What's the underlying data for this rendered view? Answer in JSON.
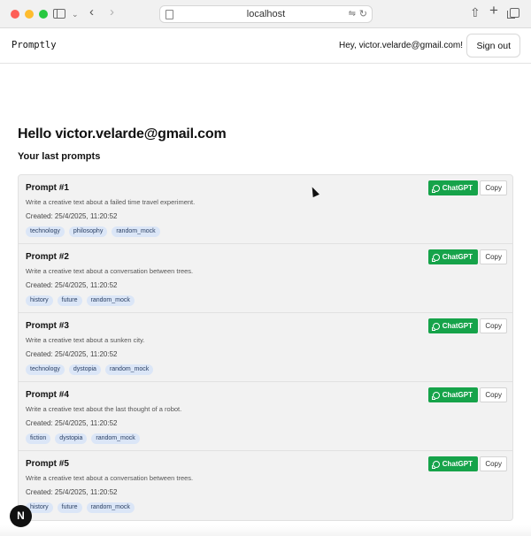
{
  "browser": {
    "url": "localhost"
  },
  "header": {
    "brand": "Promptly",
    "greeting": "Hey, victor.velarde@gmail.com!",
    "signout_label": "Sign out"
  },
  "main": {
    "title": "Hello victor.velarde@gmail.com",
    "section_title": "Your last prompts",
    "chatgpt_label": "ChatGPT",
    "copy_label": "Copy",
    "prompts": [
      {
        "title": "Prompt #1",
        "description": "Write a creative text about a failed time travel experiment.",
        "created": "Created: 25/4/2025, 11:20:52",
        "tags": [
          "technology",
          "philosophy",
          "random_mock"
        ]
      },
      {
        "title": "Prompt #2",
        "description": "Write a creative text about a conversation between trees.",
        "created": "Created: 25/4/2025, 11:20:52",
        "tags": [
          "history",
          "future",
          "random_mock"
        ]
      },
      {
        "title": "Prompt #3",
        "description": "Write a creative text about a sunken city.",
        "created": "Created: 25/4/2025, 11:20:52",
        "tags": [
          "technology",
          "dystopia",
          "random_mock"
        ]
      },
      {
        "title": "Prompt #4",
        "description": "Write a creative text about the last thought of a robot.",
        "created": "Created: 25/4/2025, 11:20:52",
        "tags": [
          "fiction",
          "dystopia",
          "random_mock"
        ]
      },
      {
        "title": "Prompt #5",
        "description": "Write a creative text about a conversation between trees.",
        "created": "Created: 25/4/2025, 11:20:52",
        "tags": [
          "history",
          "future",
          "random_mock"
        ]
      }
    ]
  },
  "badge": {
    "letter": "N"
  },
  "colors": {
    "chatgpt_green": "#16a34a",
    "tag_bg": "#dbe6f7"
  }
}
